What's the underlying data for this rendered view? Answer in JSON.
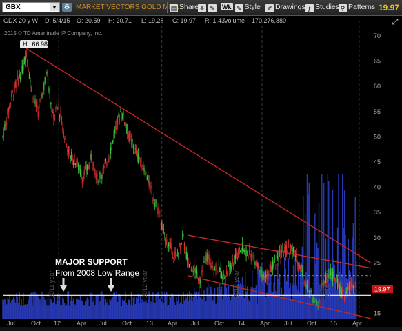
{
  "toolbar": {
    "symbol": "GBX",
    "description": "MARKET VECTORS GOLD MIN...",
    "share_label": "Share",
    "wk_label": "Wk",
    "style_label": "Style",
    "drawings_label": "Drawings",
    "studies_label": "Studies",
    "patterns_label": "Patterns",
    "last_price": "19.97"
  },
  "info_bar": {
    "period": "GDX 20 y W",
    "date": "D: 5/4/15",
    "open": "O: 20.59",
    "high": "H: 20.71",
    "low": "L: 19.28",
    "close": "C: 19.97",
    "range": "R: 1.43",
    "volume_label": "Volume",
    "volume": "170,276,880"
  },
  "copyright": "2015 © TD Ameritrade IP Company, Inc.",
  "annotations": {
    "high_label": "Hi: 66.98",
    "support_title": "MAJOR SUPPORT",
    "support_sub": "From 2008 Low Range",
    "price_tag": "19.97"
  },
  "colors": {
    "up": "#3cc43c",
    "down": "#d83030",
    "volume": "#2b3fc8",
    "trend": "#c42828",
    "support": "#ffffff",
    "price_tag_bg": "#c81818"
  },
  "chart_data": {
    "type": "candlestick",
    "y_ticks": [
      70,
      65,
      60,
      55,
      50,
      45,
      40,
      35,
      30,
      25,
      20,
      15
    ],
    "ylim": [
      14,
      73
    ],
    "x_ticks": [
      "Jul",
      "Oct",
      "12",
      "Apr",
      "Jul",
      "Oct",
      "13",
      "Apr",
      "Jul",
      "Oct",
      "14",
      "Apr",
      "Jul",
      "Oct",
      "15",
      "Apr"
    ],
    "year_markers": [
      "2011 year",
      "2012 year",
      "2013 year",
      "2014 year"
    ],
    "price_path": [
      [
        0,
        50
      ],
      [
        3,
        58
      ],
      [
        5,
        61
      ],
      [
        7,
        64
      ],
      [
        8,
        66.98
      ],
      [
        10,
        58
      ],
      [
        12,
        55
      ],
      [
        14,
        60
      ],
      [
        15,
        63
      ],
      [
        17,
        54
      ],
      [
        19,
        56
      ],
      [
        21,
        50
      ],
      [
        23,
        46
      ],
      [
        25,
        45
      ],
      [
        27,
        42
      ],
      [
        29,
        44
      ],
      [
        30,
        46
      ],
      [
        32,
        42
      ],
      [
        34,
        43
      ],
      [
        36,
        46
      ],
      [
        38,
        51
      ],
      [
        40,
        55
      ],
      [
        41,
        54
      ],
      [
        43,
        50
      ],
      [
        45,
        47
      ],
      [
        47,
        45
      ],
      [
        49,
        42
      ],
      [
        51,
        38
      ],
      [
        53,
        35
      ],
      [
        55,
        30
      ],
      [
        57,
        28
      ],
      [
        59,
        26
      ],
      [
        61,
        30
      ],
      [
        63,
        25
      ],
      [
        65,
        24
      ],
      [
        67,
        22
      ],
      [
        69,
        26
      ],
      [
        71,
        25
      ],
      [
        73,
        24
      ],
      [
        75,
        22
      ],
      [
        77,
        24
      ],
      [
        79,
        26
      ],
      [
        81,
        28
      ],
      [
        83,
        27
      ],
      [
        85,
        26
      ],
      [
        87,
        24
      ],
      [
        89,
        22
      ],
      [
        91,
        24
      ],
      [
        93,
        26
      ],
      [
        95,
        27
      ],
      [
        97,
        28
      ],
      [
        99,
        27
      ],
      [
        101,
        24
      ],
      [
        103,
        21
      ],
      [
        105,
        18
      ],
      [
        107,
        17
      ],
      [
        109,
        21
      ],
      [
        111,
        23
      ],
      [
        113,
        22
      ],
      [
        115,
        19
      ],
      [
        117,
        19.5
      ],
      [
        119,
        20.5
      ],
      [
        120,
        19.97
      ]
    ],
    "trend_lines": [
      {
        "name": "downtrend",
        "from": [
          8,
          67.5
        ],
        "to": [
          125,
          25
        ]
      },
      {
        "name": "wedge-top",
        "from": [
          63,
          30.5
        ],
        "to": [
          125,
          24
        ]
      },
      {
        "name": "wedge-bottom",
        "from": [
          63,
          22.5
        ],
        "to": [
          125,
          14
        ]
      }
    ],
    "support_level": 18.6,
    "dashed_levels": [
      22.5,
      21.0
    ]
  }
}
